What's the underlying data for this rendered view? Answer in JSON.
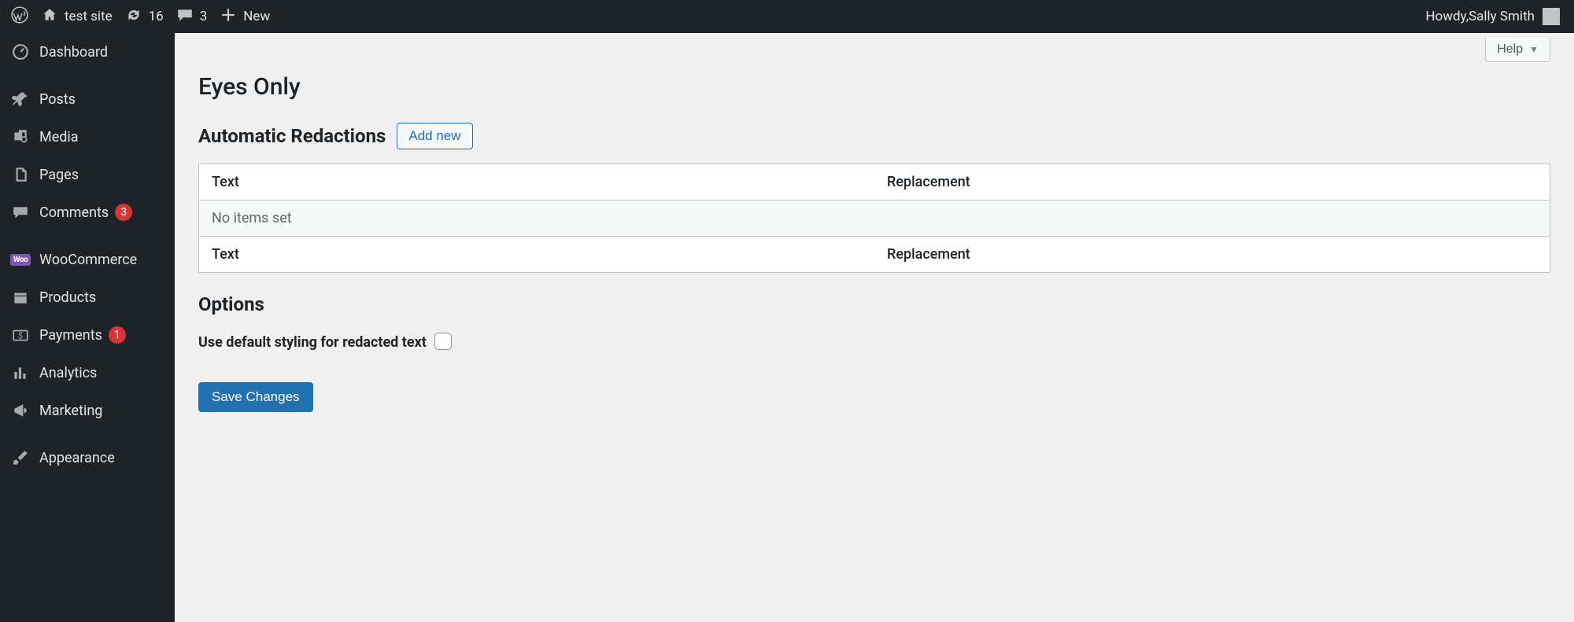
{
  "adminbar": {
    "site_name": "test site",
    "updates_count": "16",
    "comments_count": "3",
    "new_label": "New",
    "howdy_prefix": "Howdy, ",
    "user_name": "Sally Smith"
  },
  "sidebar": {
    "items": [
      {
        "icon": "dashboard",
        "label": "Dashboard"
      },
      {
        "sep": true
      },
      {
        "icon": "pin",
        "label": "Posts"
      },
      {
        "icon": "media",
        "label": "Media"
      },
      {
        "icon": "pages",
        "label": "Pages"
      },
      {
        "icon": "comment",
        "label": "Comments",
        "badge": "3"
      },
      {
        "sep": true
      },
      {
        "icon": "woo",
        "label": "WooCommerce"
      },
      {
        "icon": "products",
        "label": "Products"
      },
      {
        "icon": "payments",
        "label": "Payments",
        "badge": "1"
      },
      {
        "icon": "analytics",
        "label": "Analytics"
      },
      {
        "icon": "marketing",
        "label": "Marketing"
      },
      {
        "sep": true
      },
      {
        "icon": "appearance",
        "label": "Appearance"
      }
    ]
  },
  "main": {
    "help_label": "Help",
    "page_title": "Eyes Only",
    "section_redactions": "Automatic Redactions",
    "add_new": "Add new",
    "table": {
      "col_text": "Text",
      "col_replacement": "Replacement",
      "empty": "No items set"
    },
    "section_options": "Options",
    "option_default_styling": "Use default styling for redacted text",
    "save": "Save Changes"
  }
}
